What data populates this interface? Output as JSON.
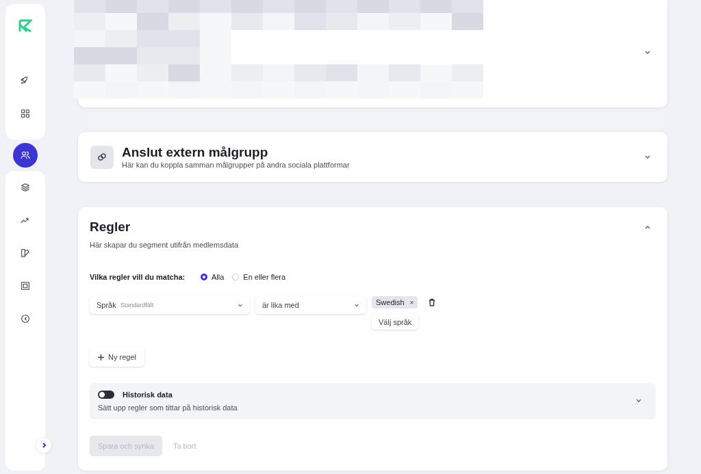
{
  "sidebar": {
    "items": [
      {
        "selected": false
      },
      {
        "selected": false
      },
      {
        "selected": true
      },
      {
        "selected": false
      },
      {
        "selected": false
      },
      {
        "selected": false
      },
      {
        "selected": false
      },
      {
        "selected": false
      }
    ]
  },
  "segment_card": {
    "expanded": false
  },
  "connect_card": {
    "title": "Anslut extern målgrupp",
    "subtitle": "Här kan du koppla samman målgrupper på andra sociala plattformar",
    "expanded": false
  },
  "rules_card": {
    "title": "Regler",
    "subtitle": "Här skapar du segment utifrån medlemsdata",
    "expanded": true,
    "match_label": "Vilka regler vill du matcha:",
    "match_options": [
      {
        "label": "Alla",
        "selected": true
      },
      {
        "label": "En eller flera",
        "selected": false
      }
    ],
    "rules": [
      {
        "field": "Språk",
        "field_hint": "Standardfält",
        "operator": "är lika med",
        "tags": [
          {
            "label": "Swedish",
            "remove": "×"
          }
        ],
        "picker": "Välj språk"
      }
    ],
    "add_rule": "Ny regel",
    "history": {
      "title": "Historisk data",
      "subtitle": "Sätt upp regler som tittar på historisk data",
      "on": false,
      "expanded": false
    },
    "buttons": [
      {
        "label": "Spara och synka",
        "kind": "primary",
        "disabled": true
      },
      {
        "label": "Ta bort",
        "kind": "link",
        "disabled": true
      }
    ]
  }
}
